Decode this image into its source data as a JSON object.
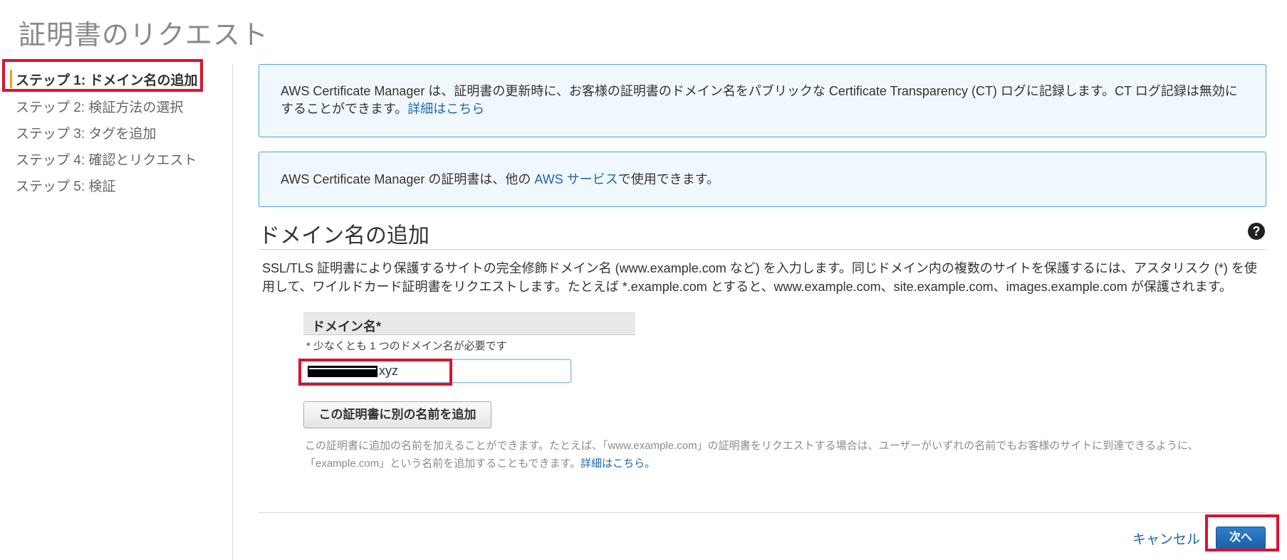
{
  "page": {
    "title": "証明書のリクエスト"
  },
  "sidebar": {
    "steps": [
      {
        "label": "ステップ 1: ドメイン名の追加",
        "active": true
      },
      {
        "label": "ステップ 2: 検証方法の選択",
        "active": false
      },
      {
        "label": "ステップ 3: タグを追加",
        "active": false
      },
      {
        "label": "ステップ 4: 確認とリクエスト",
        "active": false
      },
      {
        "label": "ステップ 5: 検証",
        "active": false
      }
    ]
  },
  "info_boxes": {
    "ct": {
      "text": "AWS Certificate Manager は、証明書の更新時に、お客様の証明書のドメイン名をパブリックな Certificate Transparency (CT) ログに記録します。CT ログ記録は無効にすることができます。",
      "link": "詳細はこちら"
    },
    "services": {
      "prefix": "AWS Certificate Manager の証明書は、他の ",
      "link": "AWS サービス",
      "suffix": "で使用できます。"
    }
  },
  "section": {
    "title": "ドメイン名の追加",
    "help_icon": "question-circle-icon",
    "description": "SSL/TLS 証明書により保護するサイトの完全修飾ドメイン名 (www.example.com など) を入力します。同じドメイン内の複数のサイトを保護するには、アスタリスク (*) を使用して、ワイルドカード証明書をリクエストします。たとえば *.example.com とすると、www.example.com、site.example.com、images.example.com が保護されます。"
  },
  "domain_field": {
    "header": "ドメイン名*",
    "note": "* 少なくとも 1 つのドメイン名が必要です",
    "value": ".xyz"
  },
  "add_name_button": {
    "label": "この証明書に別の名前を追加"
  },
  "hint": {
    "text": "この証明書に追加の名前を加えることができます。たとえば、「www.example.com」の証明書をリクエストする場合は、ユーザーがいずれの名前でもお客様のサイトに到達できるように、「example.com」という名前を追加することもできます。",
    "link": "詳細はこちら。"
  },
  "footer": {
    "cancel_label": "キャンセル",
    "next_label": "次へ"
  },
  "colors": {
    "accent": "#1a68b2",
    "highlight": "#e0112b",
    "step_bar": "#f0a30a",
    "info_bg": "#f1f8fd"
  }
}
